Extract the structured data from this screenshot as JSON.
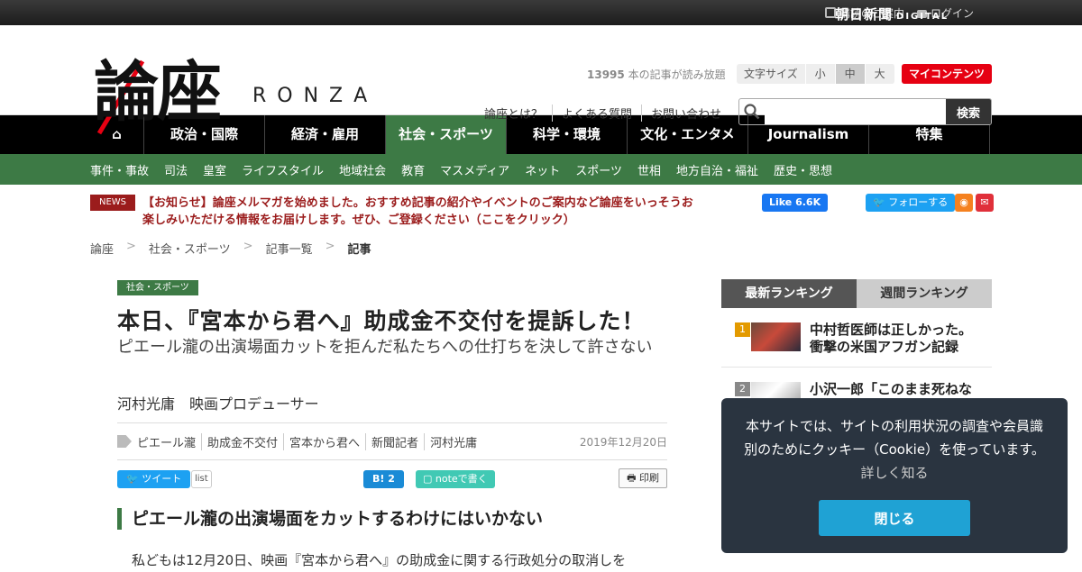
{
  "topbar": {
    "subscribe": "購読のご案内",
    "login": "ログイン",
    "asahi_brand": "朝日新聞",
    "asahi_digital": "DIGITAL"
  },
  "header": {
    "logo_main": "論座",
    "logo_sub": "RONZA",
    "read_count": "13995",
    "read_count_suffix": " 本の記事が読み放題",
    "fontsize_label": "文字サイズ",
    "fontsize_small": "小",
    "fontsize_medium": "中",
    "fontsize_large": "大",
    "my_contents": "マイコンテンツ",
    "links": [
      "論座とは？",
      "よくある質問",
      "お問い合わせ"
    ],
    "search_placeholder": "",
    "search_button": "検索"
  },
  "gnav": [
    {
      "label": "⌂",
      "w": 60
    },
    {
      "label": "政治・国際",
      "w": 134
    },
    {
      "label": "経済・雇用",
      "w": 134
    },
    {
      "label": "社会・スポーツ",
      "w": 134,
      "active": true
    },
    {
      "label": "科学・環境",
      "w": 134
    },
    {
      "label": "文化・エンタメ",
      "w": 134
    },
    {
      "label": "Journalism",
      "w": 134
    },
    {
      "label": "特集",
      "w": 134
    }
  ],
  "subnav": [
    "事件・事故",
    "司法",
    "皇室",
    "ライフスタイル",
    "地域社会",
    "教育",
    "マスメディア",
    "ネット",
    "スポーツ",
    "世相",
    "地方自治・福祉",
    "歴史・思想"
  ],
  "news": {
    "badge": "NEWS",
    "text": "【お知らせ】論座メルマガを始めました。おすすめ記事の紹介やイベントのご案内など論座をいっそうお楽しみいただける情報をお届けします。ぜひ、ご登録ください（ここをクリック）"
  },
  "social": {
    "fb": "Like 6.6K",
    "tw": "フォローする"
  },
  "breadcrumb": [
    "論座",
    "社会・スポーツ",
    "記事一覧",
    "記事"
  ],
  "article": {
    "category": "社会・スポーツ",
    "title": "本日、『宮本から君へ』助成金不交付を提訴した！",
    "subtitle": "ピエール瀧の出演場面カットを拒んだ私たちへの仕打ちを決して許さない",
    "author": "河村光庸　映画プロデューサー",
    "tags": [
      "ピエール瀧",
      "助成金不交付",
      "宮本から君へ",
      "新聞記者",
      "河村光庸"
    ],
    "date": "2019年12月20日",
    "share_tweet": "ツイート",
    "share_list": "list",
    "share_hatena": "B! 2",
    "share_note": "noteで書く",
    "share_print": "印刷",
    "h2": "ピエール瀧の出演場面をカットするわけにはいかない",
    "body_first": "私どもは12月20日、映画『宮本から君へ』の助成金に関する行政処分の取消しを"
  },
  "ranking": {
    "tab_latest": "最新ランキング",
    "tab_weekly": "週間ランキング",
    "items": [
      {
        "num": "1",
        "color": "#e39a00",
        "text": "中村哲医師は正しかった。衝撃の米国アフガン記録"
      },
      {
        "num": "2",
        "color": "#888888",
        "text": "小沢一郎「このまま死ねない」"
      }
    ]
  },
  "cookie": {
    "text": "本サイトでは、サイトの利用状況の調査や会員識別のためにクッキー（Cookie）を使っています。",
    "more": "詳しく知る",
    "close": "閉じる"
  }
}
